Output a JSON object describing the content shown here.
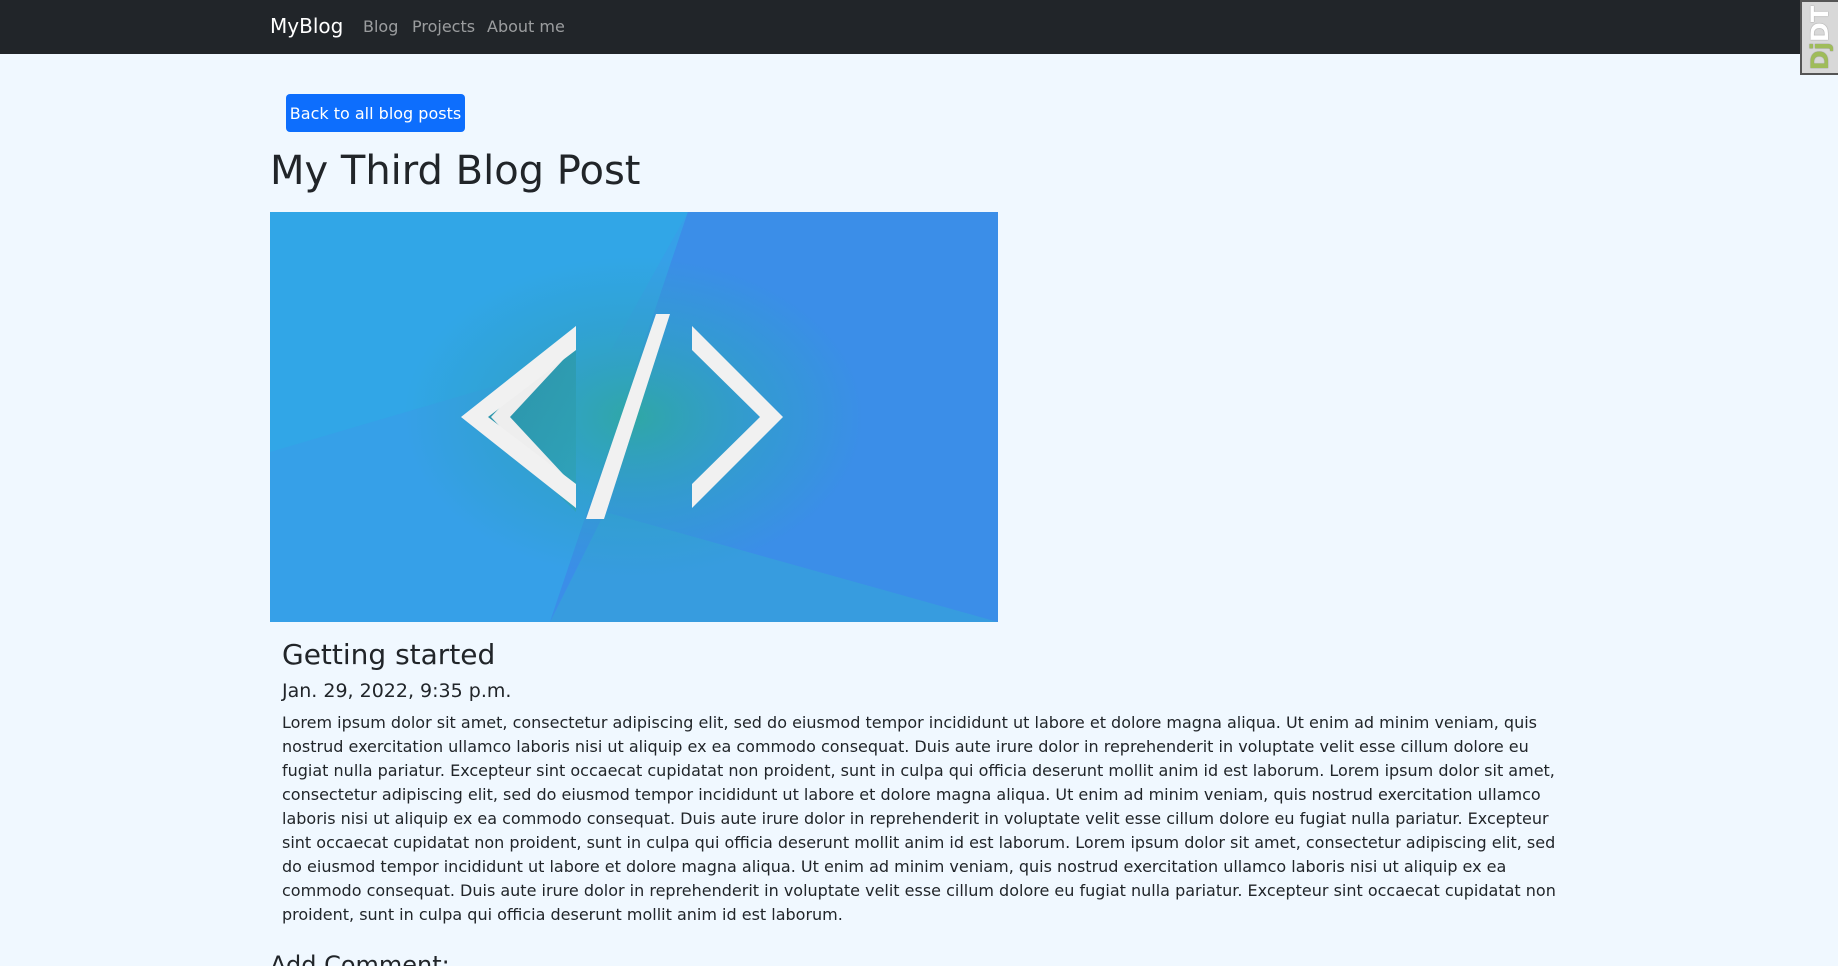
{
  "navbar": {
    "brand": "MyBlog",
    "links": [
      {
        "label": "Blog"
      },
      {
        "label": "Projects"
      },
      {
        "label": "About me"
      }
    ]
  },
  "debug_toolbar": {
    "label_prefix": "Dj",
    "label_suffix": "DT"
  },
  "post": {
    "back_label": "Back to all blog posts",
    "title": "My Third Blog Post",
    "card_title": "Getting started",
    "date": "Jan. 29, 2022, 9:35 p.m.",
    "body": "Lorem ipsum dolor sit amet, consectetur adipiscing elit, sed do eiusmod tempor incididunt ut labore et dolore magna aliqua. Ut enim ad minim veniam, quis nostrud exercitation ullamco laboris nisi ut aliquip ex ea commodo consequat. Duis aute irure dolor in reprehenderit in voluptate velit esse cillum dolore eu fugiat nulla pariatur. Excepteur sint occaecat cupidatat non proident, sunt in culpa qui officia deserunt mollit anim id est laborum. Lorem ipsum dolor sit amet, consectetur adipiscing elit, sed do eiusmod tempor incididunt ut labore et dolore magna aliqua. Ut enim ad minim veniam, quis nostrud exercitation ullamco laboris nisi ut aliquip ex ea commodo consequat. Duis aute irure dolor in reprehenderit in voluptate velit esse cillum dolore eu fugiat nulla pariatur. Excepteur sint occaecat cupidatat non proident, sunt in culpa qui officia deserunt mollit anim id est laborum. Lorem ipsum dolor sit amet, consectetur adipiscing elit, sed do eiusmod tempor incididunt ut labore et dolore magna aliqua. Ut enim ad minim veniam, quis nostrud exercitation ullamco laboris nisi ut aliquip ex ea commodo consequat. Duis aute irure dolor in reprehenderit in voluptate velit esse cillum dolore eu fugiat nulla pariatur. Excepteur sint occaecat cupidatat non proident, sunt in culpa qui officia deserunt mollit anim id est laborum.",
    "image_icon": "code-icon"
  },
  "comments": {
    "heading": "Add Comment:"
  },
  "colors": {
    "navbar_bg": "#212529",
    "page_bg": "#f0f8ff",
    "button_primary": "#0d6efd",
    "hero_blue": "#3a8ee6"
  }
}
